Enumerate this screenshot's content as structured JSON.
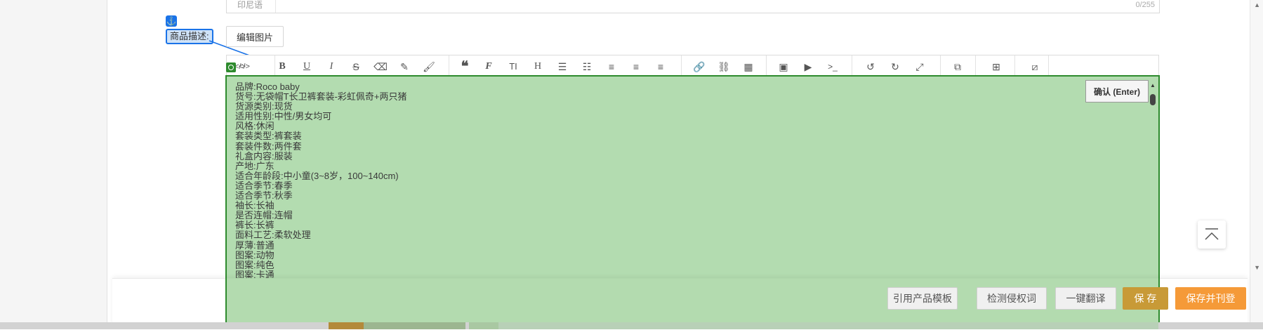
{
  "top_field": {
    "label": "印尼语",
    "counter": "0/255"
  },
  "anchor_icon": "anchor-icon",
  "description_label": "商品描述:",
  "edit_image_button": "编辑图片",
  "toolbar": {
    "icons": [
      "source-code-icon",
      "bold-icon",
      "underline-icon",
      "italic-icon",
      "strikethrough-icon",
      "eraser-icon",
      "brush-icon",
      "format-painter-icon",
      "quote-icon",
      "font-icon",
      "font-size-icon",
      "heading-icon",
      "bullet-list-icon",
      "numbered-list-icon",
      "align-left-icon",
      "align-center-icon",
      "align-right-icon",
      "link-icon",
      "unlink-icon",
      "table-icon",
      "image-icon",
      "video-icon",
      "code-icon",
      "undo-icon",
      "redo-icon",
      "fullscreen-icon",
      "gallery-icon",
      "grid-icon",
      "image-edit-icon"
    ]
  },
  "confirm_button": "确认 (Enter)",
  "description_lines": [
    "品牌:Roco baby",
    "货号:无袋帽T长卫裤套装-彩虹佩奇+两只猪",
    "货源类别:现货",
    "适用性别:中性/男女均可",
    "风格:休闲",
    "套装类型:裤套装",
    "套装件数:两件套",
    "礼盒内容:服装",
    "产地:广东",
    "适合年龄段:中小童(3~8岁，100~140cm)",
    "适合季节:春季",
    "适合季节:秋季",
    "袖长:长袖",
    "是否连帽:连帽",
    "裤长:长裤",
    "面料工艺:柔软处理",
    "厚薄:普通",
    "图案:动物",
    "图案:纯色",
    "图案:卡通"
  ],
  "actions": {
    "use_template": "引用产品模板",
    "detect_infringe": "检测侵权词",
    "one_click_translate": "一键翻译",
    "save": "保 存",
    "save_publish": "保存并刊登"
  },
  "colors": {
    "selection_green": "#b3dcb0",
    "selection_border": "#2e8b2e",
    "accent_orange": "#f59a38",
    "anchor_blue": "#1a73e8"
  },
  "back_to_top_icon": "back-to-top-icon"
}
